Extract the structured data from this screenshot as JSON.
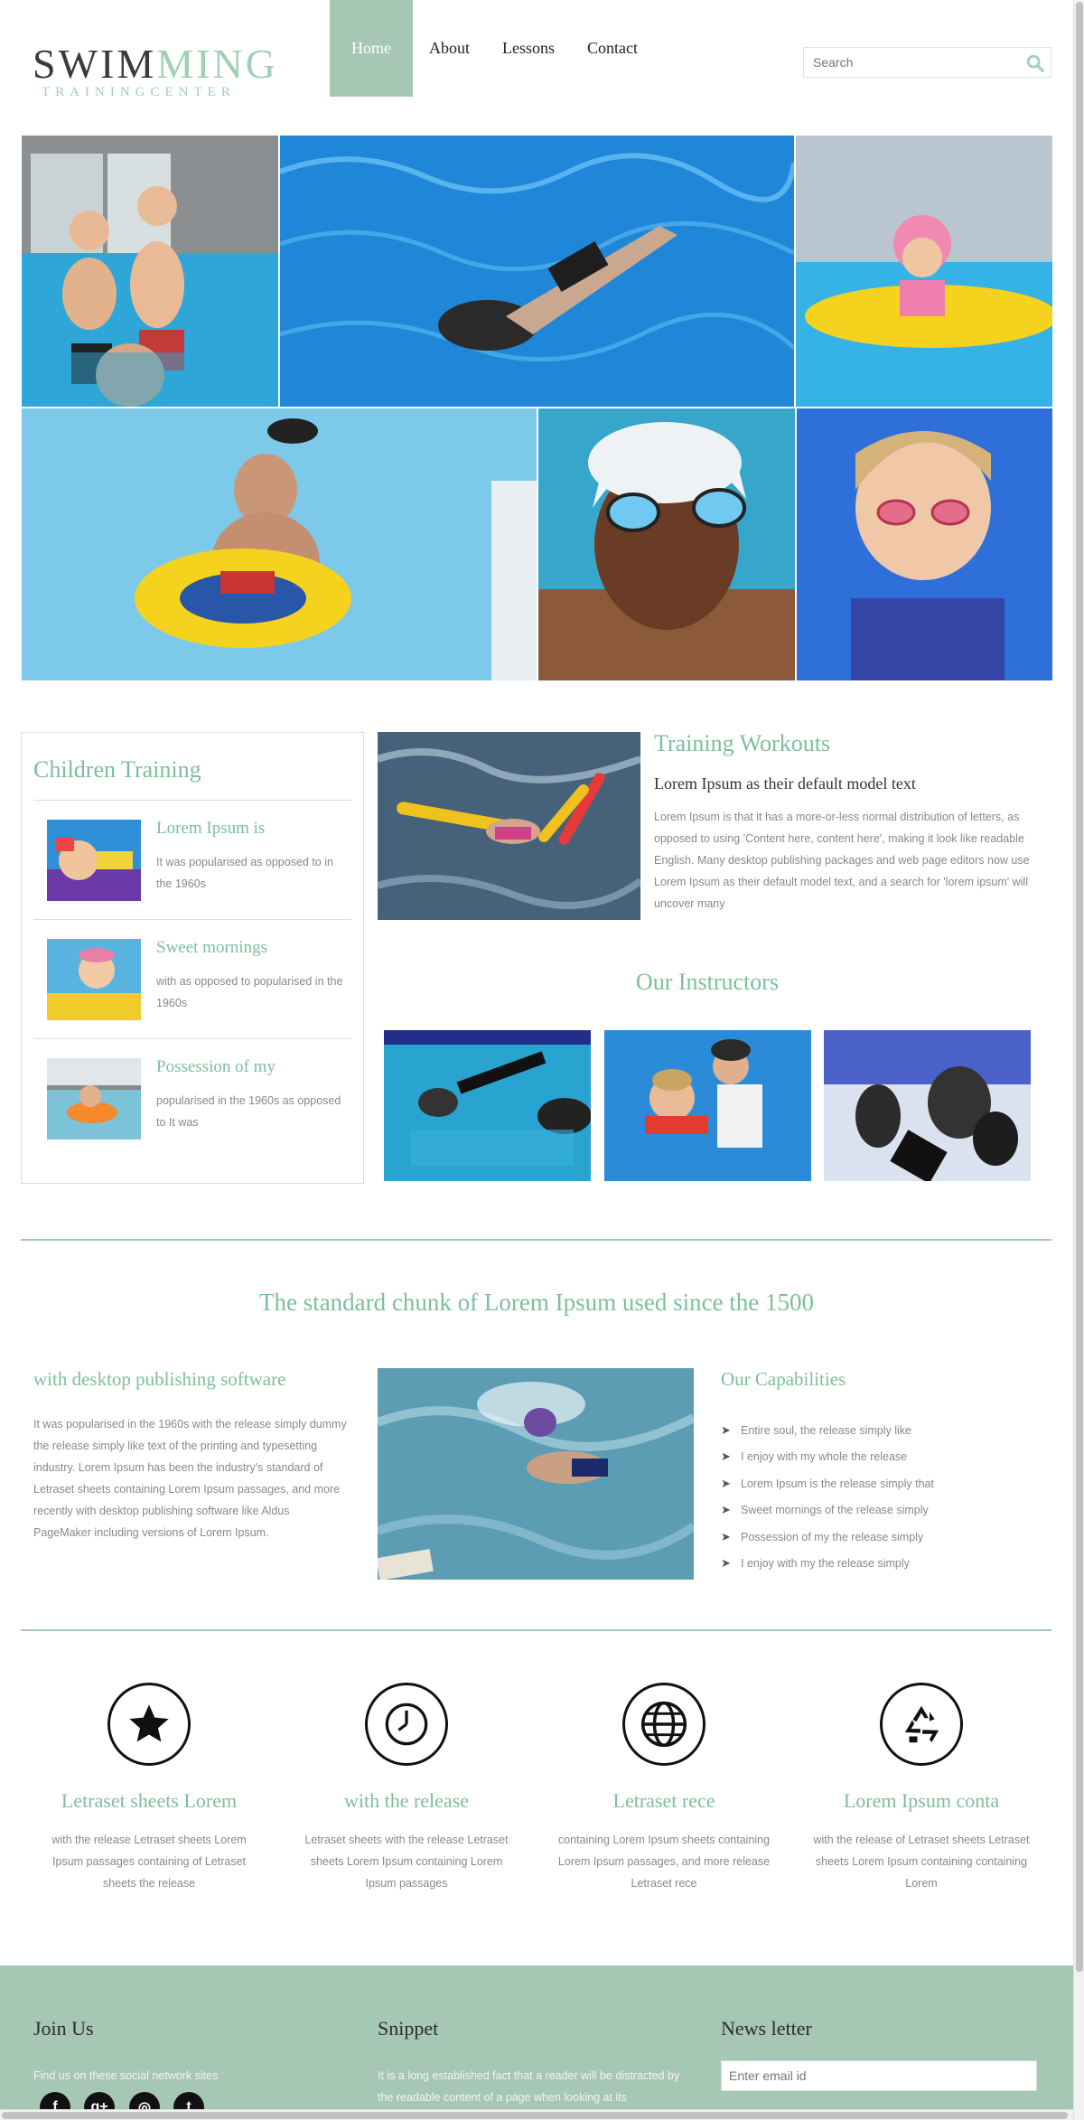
{
  "header": {
    "logo_part1": "SWIM",
    "logo_part2": "MING",
    "logo_sub": "TRAININGCENTER",
    "nav": [
      "Home",
      "About",
      "Lessons",
      "Contact"
    ],
    "search_placeholder": "Search"
  },
  "colors": {
    "accent": "#7cbf99",
    "nav_active": "#a6c7b3",
    "footer_bg": "#a6c7b3",
    "text_muted": "#888888"
  },
  "sidebar": {
    "title": "Children Training",
    "items": [
      {
        "title": "Lorem Ipsum is",
        "text": "It was popularised as opposed to in the 1960s"
      },
      {
        "title": "Sweet mornings",
        "text": "with as opposed to popularised in the 1960s"
      },
      {
        "title": "Possession of my",
        "text": "popularised in the 1960s as opposed to It was"
      }
    ]
  },
  "training": {
    "title": "Training Workouts",
    "subtitle": "Lorem Ipsum as their default model text",
    "text": "Lorem Ipsum is that it has a more-or-less normal distribution of letters, as opposed to using 'Content here, content here', making it look like readable English. Many desktop publishing packages and web page editors now use Lorem Ipsum as their default model text, and a search for 'lorem ipsum' will uncover many"
  },
  "instructors": {
    "title": "Our Instructors"
  },
  "chunk": {
    "title": "The standard chunk of Lorem Ipsum used since the 1500"
  },
  "desktop": {
    "title": "with desktop publishing software",
    "text": "It was popularised in the 1960s with the release simply dummy the release simply like text of the printing and typesetting industry. Lorem Ipsum has been the industry's standard of Letraset sheets containing Lorem Ipsum passages, and more recently with desktop publishing software like Aldus PageMaker including versions of Lorem Ipsum."
  },
  "capabilities": {
    "title": "Our Capabilities",
    "items": [
      "Entire soul, the release simply like",
      "I enjoy with my whole the release",
      "Lorem Ipsum is the release simply that",
      "Sweet mornings of the release simply",
      "Possession of my the release simply",
      "I enjoy with my the release simply"
    ]
  },
  "features": [
    {
      "icon": "star-icon",
      "title": "Letraset sheets Lorem",
      "text": "with the release Letraset sheets Lorem Ipsum passages containing of Letraset sheets the release"
    },
    {
      "icon": "clock-icon",
      "title": "with the release",
      "text": "Letraset sheets with the release Letraset sheets Lorem Ipsum containing Lorem Ipsum passages"
    },
    {
      "icon": "globe-icon",
      "title": "Letraset rece",
      "text": "containing Lorem Ipsum sheets containing Lorem Ipsum passages, and more release Letraset rece"
    },
    {
      "icon": "recycle-icon",
      "title": "Lorem Ipsum conta",
      "text": "with the release of Letraset sheets Letraset sheets Lorem Ipsum containing containing Lorem"
    }
  ],
  "footer": {
    "join_title": "Join Us",
    "join_text": "Find us on these social network sites",
    "snippet_title": "Snippet",
    "snippet_text": "It is a long established fact that a reader will be distracted by the readable content of a page when looking at its",
    "news_title": "News letter",
    "email_placeholder": "Enter email id",
    "social": [
      "facebook-icon",
      "google-plus-icon",
      "instagram-icon",
      "twitter-icon"
    ]
  }
}
